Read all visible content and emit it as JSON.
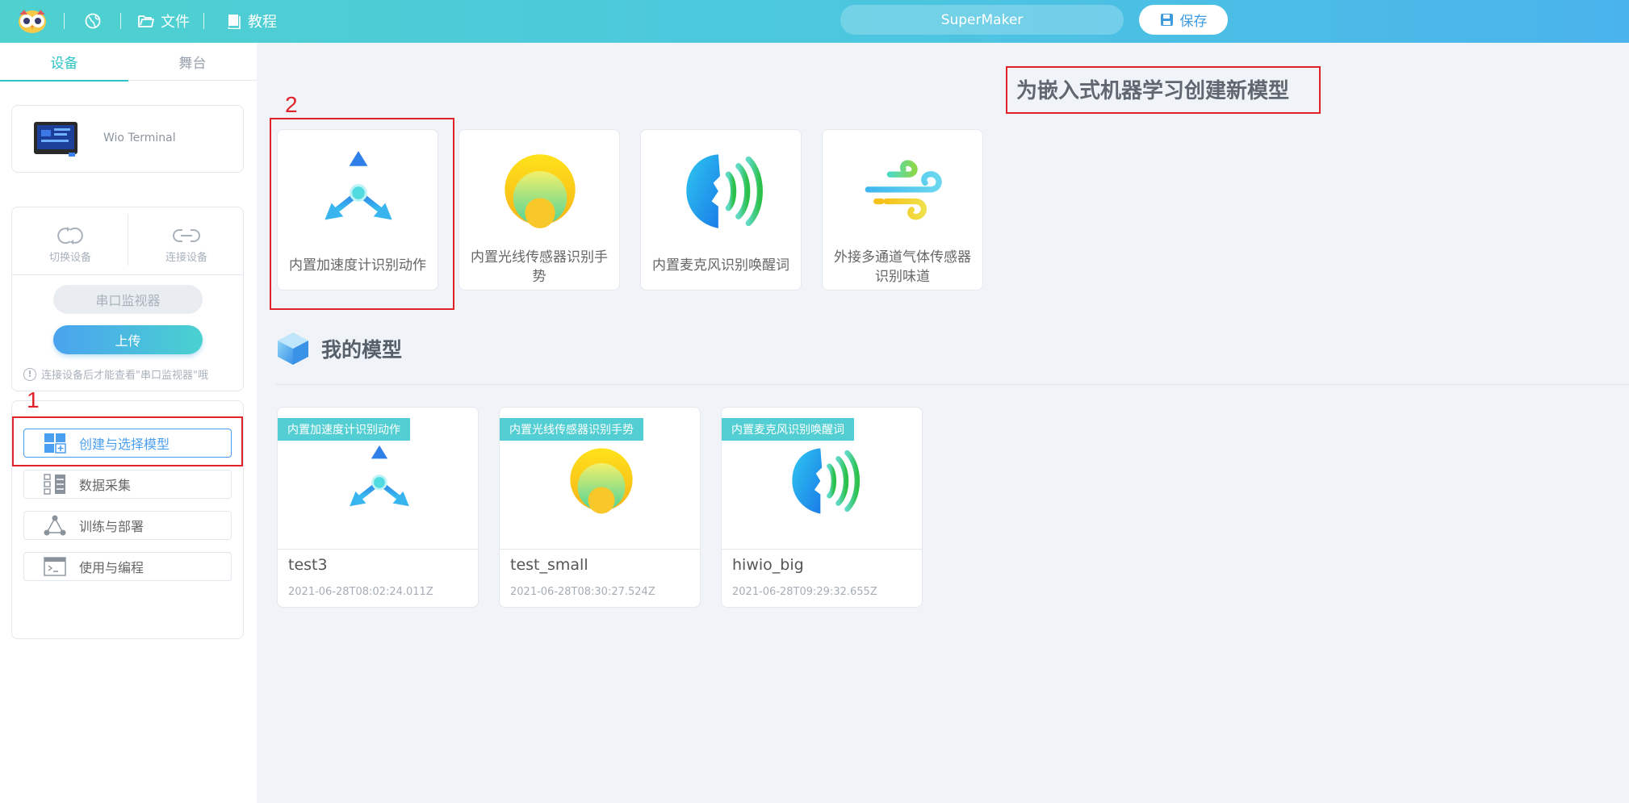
{
  "topbar": {
    "file_label": "文件",
    "tutorial_label": "教程",
    "project_name": "SuperMaker",
    "save_label": "保存"
  },
  "sidebar": {
    "tabs": [
      {
        "label": "设备",
        "active": true
      },
      {
        "label": "舞台",
        "active": false
      }
    ],
    "device_name": "Wio Terminal",
    "switch_device_label": "切换设备",
    "connect_device_label": "连接设备",
    "serial_monitor_label": "串口监视器",
    "upload_label": "上传",
    "hint_text": "连接设备后才能查看\"串口监视器\"哦",
    "steps": [
      {
        "label": "创建与选择模型",
        "active": true
      },
      {
        "label": "数据采集",
        "active": false
      },
      {
        "label": "训练与部署",
        "active": false
      },
      {
        "label": "使用与编程",
        "active": false
      }
    ]
  },
  "annotations": {
    "step1": "1",
    "step2": "2"
  },
  "main": {
    "create_title": "为嵌入式机器学习创建新模型",
    "model_types": [
      {
        "label": "内置加速度计识别动作",
        "icon": "accelerometer-icon"
      },
      {
        "label": "内置光线传感器识别手势",
        "icon": "light-sensor-icon"
      },
      {
        "label": "内置麦克风识别唤醒词",
        "icon": "microphone-icon"
      },
      {
        "label": "外接多通道气体传感器识别味道",
        "icon": "gas-sensor-icon"
      }
    ],
    "my_models_title": "我的模型",
    "my_models": [
      {
        "tag": "内置加速度计识别动作",
        "name": "test3",
        "date": "2021-06-28T08:02:24.011Z",
        "icon": "accelerometer-icon"
      },
      {
        "tag": "内置光线传感器识别手势",
        "name": "test_small",
        "date": "2021-06-28T08:30:27.524Z",
        "icon": "light-sensor-icon"
      },
      {
        "tag": "内置麦克风识别唤醒词",
        "name": "hiwio_big",
        "date": "2021-06-28T09:29:32.655Z",
        "icon": "microphone-icon"
      }
    ]
  },
  "colors": {
    "accent": "#2fc4c8",
    "primary_blue": "#4b9ff0",
    "annotation_red": "#e0222b"
  }
}
